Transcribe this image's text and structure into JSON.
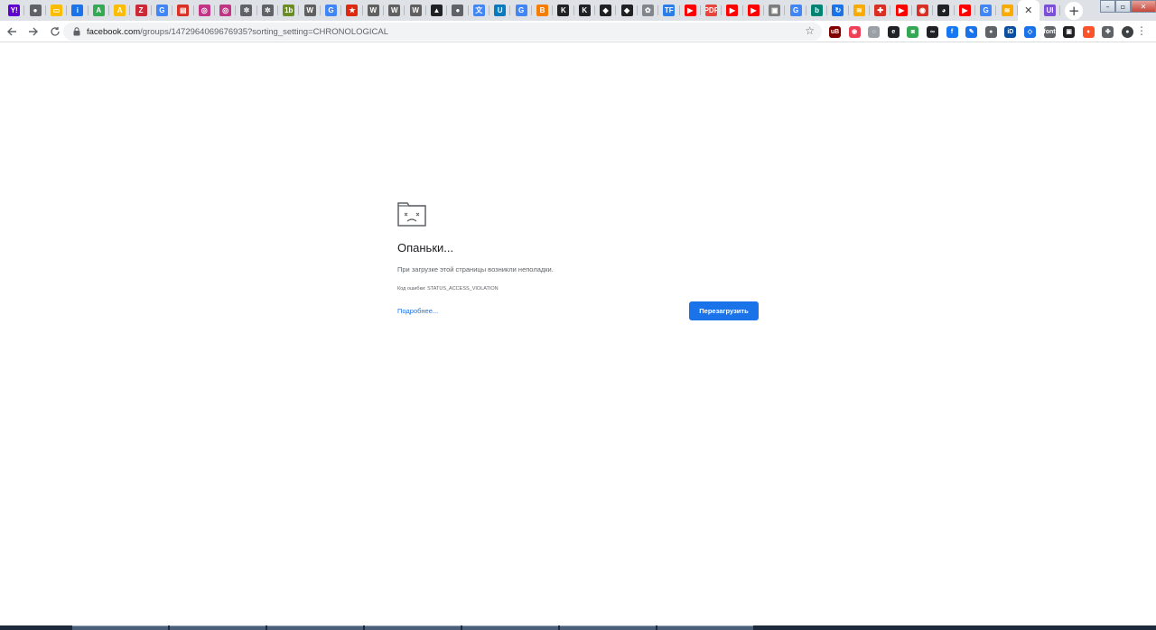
{
  "browser": {
    "tabs": [
      {
        "icon": "yahoo-icon",
        "color": "#5f01d1",
        "glyph": "Y!"
      },
      {
        "icon": "globe-icon",
        "color": "#5f6368",
        "glyph": "●"
      },
      {
        "icon": "keep-icon",
        "color": "#fbbc04",
        "glyph": "▭"
      },
      {
        "icon": "info-icon",
        "color": "#1a73e8",
        "glyph": "i"
      },
      {
        "icon": "google-ads-icon",
        "color": "#34a853",
        "glyph": "A"
      },
      {
        "icon": "google-ads-icon",
        "color": "#fbbc04",
        "glyph": "A"
      },
      {
        "icon": "zotero-icon",
        "color": "#cc2936",
        "glyph": "Z"
      },
      {
        "icon": "google-icon",
        "color": "#4285f4",
        "glyph": "G"
      },
      {
        "icon": "printer-icon",
        "color": "#d93025",
        "glyph": "▤"
      },
      {
        "icon": "instagram-icon",
        "color": "#c13584",
        "glyph": "◎"
      },
      {
        "icon": "instagram-icon",
        "color": "#c13584",
        "glyph": "◎"
      },
      {
        "icon": "gear-globe-icon",
        "color": "#5f6368",
        "glyph": "✲"
      },
      {
        "icon": "gear-globe-icon",
        "color": "#5f6368",
        "glyph": "✲"
      },
      {
        "icon": "ib-icon",
        "color": "#6b8e23",
        "glyph": "1b"
      },
      {
        "icon": "wm-icon",
        "color": "#606060",
        "glyph": "W"
      },
      {
        "icon": "google-icon",
        "color": "#4285f4",
        "glyph": "G"
      },
      {
        "icon": "flag-icon",
        "color": "#de2910",
        "glyph": "★"
      },
      {
        "icon": "wm-icon",
        "color": "#606060",
        "glyph": "W"
      },
      {
        "icon": "wm-icon",
        "color": "#606060",
        "glyph": "W"
      },
      {
        "icon": "wm-icon",
        "color": "#606060",
        "glyph": "W"
      },
      {
        "icon": "mountain-icon",
        "color": "#202124",
        "glyph": "▲"
      },
      {
        "icon": "globe-icon",
        "color": "#5f6368",
        "glyph": "●"
      },
      {
        "icon": "translate-icon",
        "color": "#4285f4",
        "glyph": "文"
      },
      {
        "icon": "u-icon",
        "color": "#0a7abf",
        "glyph": "U"
      },
      {
        "icon": "google-icon",
        "color": "#4285f4",
        "glyph": "G"
      },
      {
        "icon": "blogger-icon",
        "color": "#f57d00",
        "glyph": "B"
      },
      {
        "icon": "k-icon",
        "color": "#202124",
        "glyph": "K"
      },
      {
        "icon": "k-icon",
        "color": "#202124",
        "glyph": "K"
      },
      {
        "icon": "cube-icon",
        "color": "#202124",
        "glyph": "◆"
      },
      {
        "icon": "cube-icon",
        "color": "#202124",
        "glyph": "◆"
      },
      {
        "icon": "gear-icon",
        "color": "#80868b",
        "glyph": "✿"
      },
      {
        "icon": "tf-icon",
        "color": "#2b7de9",
        "glyph": "TF"
      },
      {
        "icon": "youtube-icon",
        "color": "#ff0000",
        "glyph": "▶"
      },
      {
        "icon": "pdf-icon",
        "color": "#e8453c",
        "glyph": "PDF"
      },
      {
        "icon": "youtube-icon",
        "color": "#ff0000",
        "glyph": "▶"
      },
      {
        "icon": "youtube-icon",
        "color": "#ff0000",
        "glyph": "▶"
      },
      {
        "icon": "archive-icon",
        "color": "#7d7d7d",
        "glyph": "▣"
      },
      {
        "icon": "google-icon",
        "color": "#4285f4",
        "glyph": "G"
      },
      {
        "icon": "bing-icon",
        "color": "#008373",
        "glyph": "b"
      },
      {
        "icon": "refresh-icon",
        "color": "#1a73e8",
        "glyph": "↻"
      },
      {
        "icon": "analytics-icon",
        "color": "#f9ab00",
        "glyph": "≋"
      },
      {
        "icon": "health-icon",
        "color": "#d93025",
        "glyph": "✚"
      },
      {
        "icon": "youtube-icon",
        "color": "#ff0000",
        "glyph": "▶"
      },
      {
        "icon": "target-icon",
        "color": "#d93025",
        "glyph": "◉"
      },
      {
        "icon": "github-icon",
        "color": "#202124",
        "glyph": "◕"
      },
      {
        "icon": "youtube-icon",
        "color": "#ff0000",
        "glyph": "▶"
      },
      {
        "icon": "google-icon",
        "color": "#4285f4",
        "glyph": "G"
      },
      {
        "icon": "analytics-icon",
        "color": "#f9ab00",
        "glyph": "≋"
      }
    ],
    "active_tab": {
      "icon": "ui-icon",
      "color": "#7b4fd6",
      "glyph": "UI"
    },
    "address": {
      "host": "facebook.com",
      "path": "/groups/1472964069676935?sorting_setting=CHRONOLOGICAL"
    },
    "extensions": [
      {
        "icon": "ublock-icon",
        "color": "#800000",
        "glyph": "uB"
      },
      {
        "icon": "pocket-icon",
        "color": "#ef4056",
        "glyph": "◉"
      },
      {
        "icon": "circle-icon",
        "color": "#9aa0a6",
        "glyph": "○"
      },
      {
        "icon": "e-icon",
        "color": "#202124",
        "glyph": "e"
      },
      {
        "icon": "camera-icon",
        "color": "#34a853",
        "glyph": "◙"
      },
      {
        "icon": "glasses-icon",
        "color": "#202124",
        "glyph": "∞"
      },
      {
        "icon": "facebook-icon",
        "color": "#1877f2",
        "glyph": "f"
      },
      {
        "icon": "pen-icon",
        "color": "#1a73e8",
        "glyph": "✎"
      },
      {
        "icon": "lock-ext-icon",
        "color": "#5f6368",
        "glyph": "●"
      },
      {
        "icon": "id-icon",
        "color": "#0a4ea1",
        "glyph": "iD"
      },
      {
        "icon": "shield-ext-icon",
        "color": "#1a73e8",
        "glyph": "◇"
      },
      {
        "icon": "font-icon",
        "color": "#5f6368",
        "glyph": "font"
      },
      {
        "icon": "box-icon",
        "color": "#202124",
        "glyph": "▣"
      },
      {
        "icon": "brave-icon",
        "color": "#fb542b",
        "glyph": "♦"
      },
      {
        "icon": "puzzle-icon",
        "color": "#5f6368",
        "glyph": "✤"
      },
      {
        "icon": "avatar-icon",
        "color": "#3c4043",
        "glyph": "●"
      }
    ]
  },
  "crash_page": {
    "heading": "Опаньки...",
    "message": "При загрузке этой страницы возникли неполадки.",
    "error_code": "Код ошибки: STATUS_ACCESS_VIOLATION",
    "learn_more": "Подробнее...",
    "reload_label": "Перезагрузить"
  },
  "colors": {
    "accent": "#1a73e8",
    "text": "#202124",
    "secondary_text": "#5f6368"
  }
}
